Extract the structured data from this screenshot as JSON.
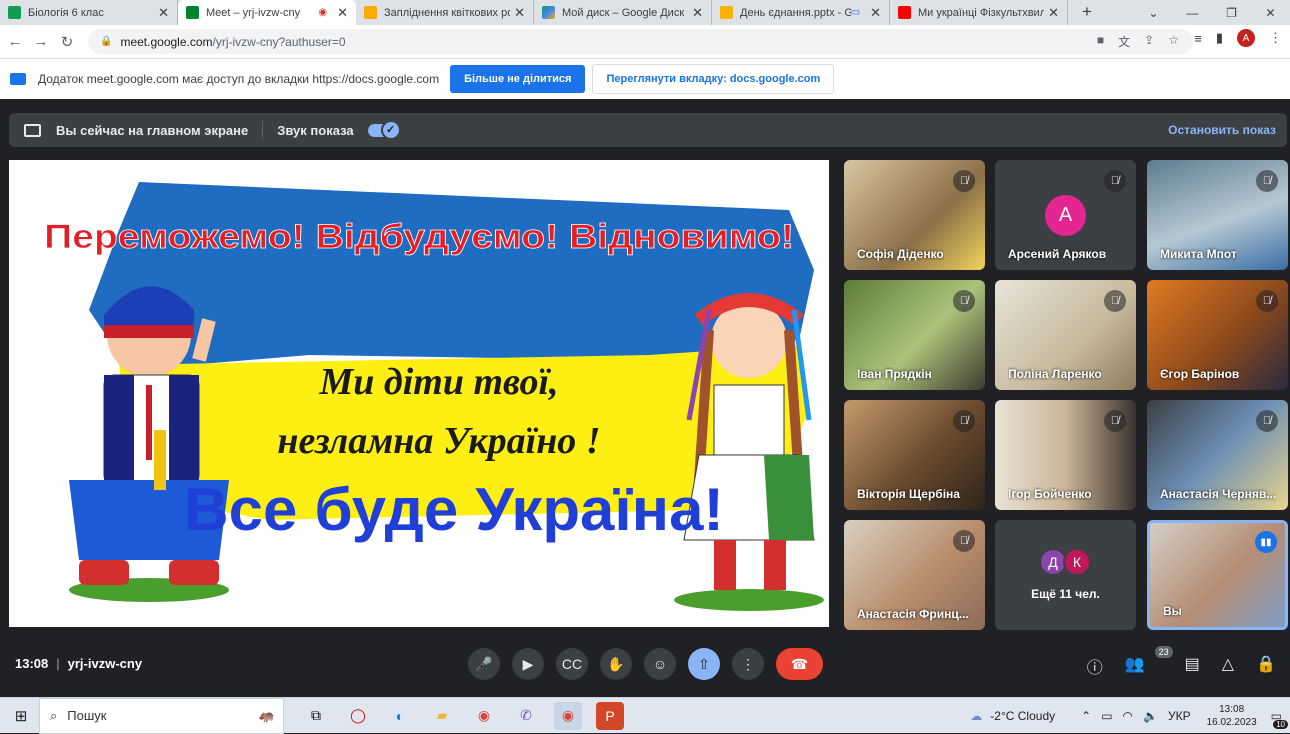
{
  "browser": {
    "tabs": [
      {
        "title": "Біологія 6 клас",
        "color": "#0f9d58"
      },
      {
        "title": "Meet – yrj-ivzw-cny",
        "color": "#00832d",
        "active": true,
        "recording": true
      },
      {
        "title": "Запліднення квіткових рос",
        "color": "#f9ab00"
      },
      {
        "title": "Мой диск – Google Диск",
        "color": "#4285f4"
      },
      {
        "title": "День єднання.pptx - G",
        "color": "#f4b400"
      },
      {
        "title": "Ми українці Фізкультхвил",
        "color": "#ff0000"
      }
    ],
    "url_host": "meet.google.com",
    "url_path": "/yrj-ivzw-cny?authuser=0",
    "profile_initial": "A"
  },
  "infobar": {
    "message": "Додаток meet.google.com має доступ до вкладки https://docs.google.com",
    "stop_label": "Більше не ділитися",
    "view_label": "Переглянути вкладку: docs.google.com"
  },
  "presenting": {
    "status": "Вы сейчас на главном экране",
    "audio_label": "Звук показа",
    "stop_label": "Остановить показ"
  },
  "slide": {
    "line1": "Переможемо! Відбудуємо! Відновимо!",
    "line2": "Ми діти твої,",
    "line3": "незламна Україно !",
    "line4": "Все буде Україна!"
  },
  "participants": [
    {
      "name": "Софія Діденко",
      "muted": true
    },
    {
      "name": "Арсений Аряков",
      "muted": true,
      "avatar": "A"
    },
    {
      "name": "Микита Мпот",
      "muted": true
    },
    {
      "name": "Іван Прядкін",
      "muted": true
    },
    {
      "name": "Поліна Ларенко",
      "muted": true
    },
    {
      "name": "Єгор Барінов",
      "muted": true
    },
    {
      "name": "Вікторія Щербіна",
      "muted": true
    },
    {
      "name": "Ігор Бойченко",
      "muted": true
    },
    {
      "name": "Анастасія Черняв...",
      "muted": true
    },
    {
      "name": "Анастасія Фринц...",
      "muted": true
    },
    {
      "more_label": "Ещё 11 чел.",
      "initials": [
        "Д",
        "К"
      ]
    },
    {
      "name": "Вы",
      "speaking": true
    }
  ],
  "bottom": {
    "time": "13:08",
    "meeting_code": "yrj-ivzw-cny",
    "people_count": "23"
  },
  "taskbar": {
    "search_placeholder": "Пошук",
    "weather": "-2°C  Cloudy",
    "lang": "УКР",
    "time": "13:08",
    "date": "16.02.2023",
    "notif_count": "10"
  }
}
